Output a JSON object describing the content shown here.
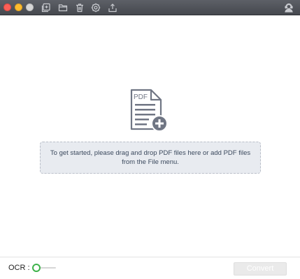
{
  "window": {
    "buttons": [
      "close",
      "minimize",
      "zoom"
    ]
  },
  "toolbar": {
    "icons": [
      {
        "name": "add-files-icon"
      },
      {
        "name": "open-folder-icon"
      },
      {
        "name": "delete-icon"
      },
      {
        "name": "settings-icon"
      },
      {
        "name": "export-icon"
      }
    ],
    "right_icon": "support-icon",
    "colors": {
      "background": "#4f5258",
      "icon": "#c9cbd0"
    }
  },
  "drop_zone": {
    "icon_label": "PDF",
    "hint": "To get started, please drag and drop PDF files here or add PDF files from the File menu."
  },
  "bottom_bar": {
    "ocr_label": "OCR :",
    "ocr_enabled": false,
    "convert_label": "Convert",
    "convert_enabled": false,
    "accent": "#3db24a"
  }
}
